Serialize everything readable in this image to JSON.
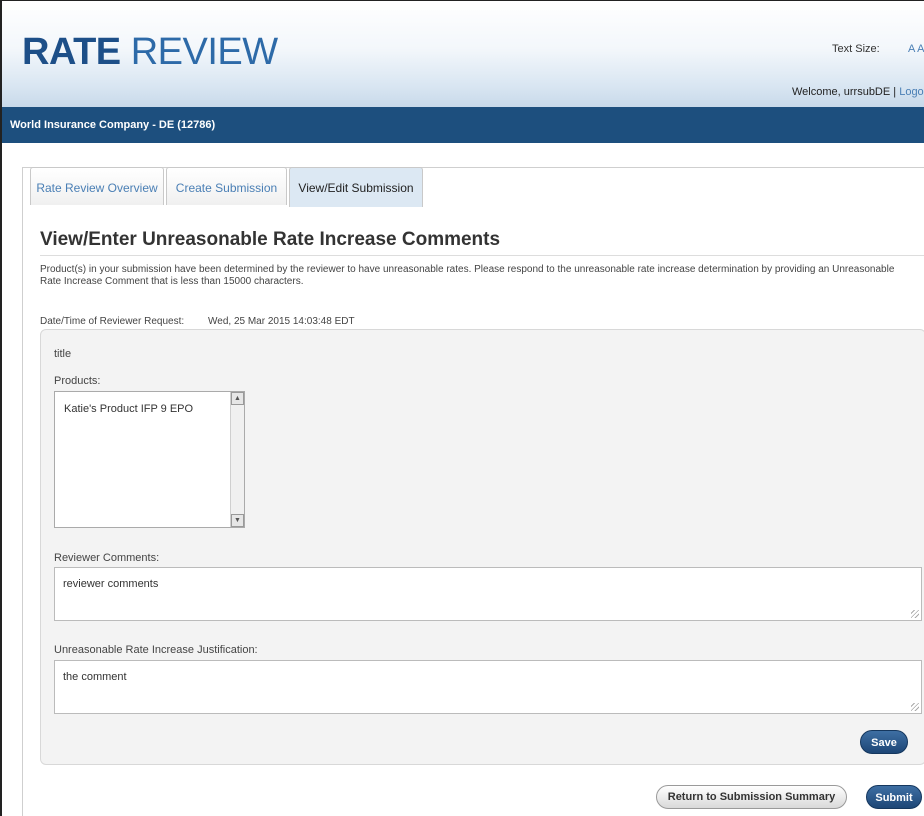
{
  "header": {
    "logo_bold": "RATE",
    "logo_thin": "REVIEW",
    "text_size_label": "Text Size:",
    "text_size_options": "A A",
    "welcome": "Welcome, urrsubDE",
    "separator": "|",
    "logout": "Logo"
  },
  "company": {
    "name": "World Insurance Company - DE (12786)"
  },
  "tabs": [
    {
      "label": "Rate Review Overview"
    },
    {
      "label": "Create Submission"
    },
    {
      "label": "View/Edit Submission"
    }
  ],
  "page": {
    "title": "View/Enter Unreasonable Rate Increase Comments",
    "intro": "Product(s) in your submission have been determined by the reviewer to have unreasonable rates. Please respond to the unreasonable rate increase determination by providing an Unreasonable Rate Increase Comment that is less than 15000 characters.",
    "request_label": "Date/Time of Reviewer Request:",
    "request_value": "Wed, 25 Mar 2015 14:03:48 EDT"
  },
  "form": {
    "section_title": "title",
    "products_label": "Products:",
    "products": [
      "Katie's Product IFP 9 EPO"
    ],
    "reviewer_comments_label": "Reviewer Comments:",
    "reviewer_comments_value": "reviewer comments",
    "justification_label": "Unreasonable Rate Increase Justification:",
    "justification_value": "the comment",
    "save_label": "Save"
  },
  "actions": {
    "return_label": "Return to Submission Summary",
    "submit_label": "Submit"
  },
  "colors": {
    "brand": "#1d4f88",
    "bar": "#1d4f7e",
    "link": "#4a7fb5"
  }
}
